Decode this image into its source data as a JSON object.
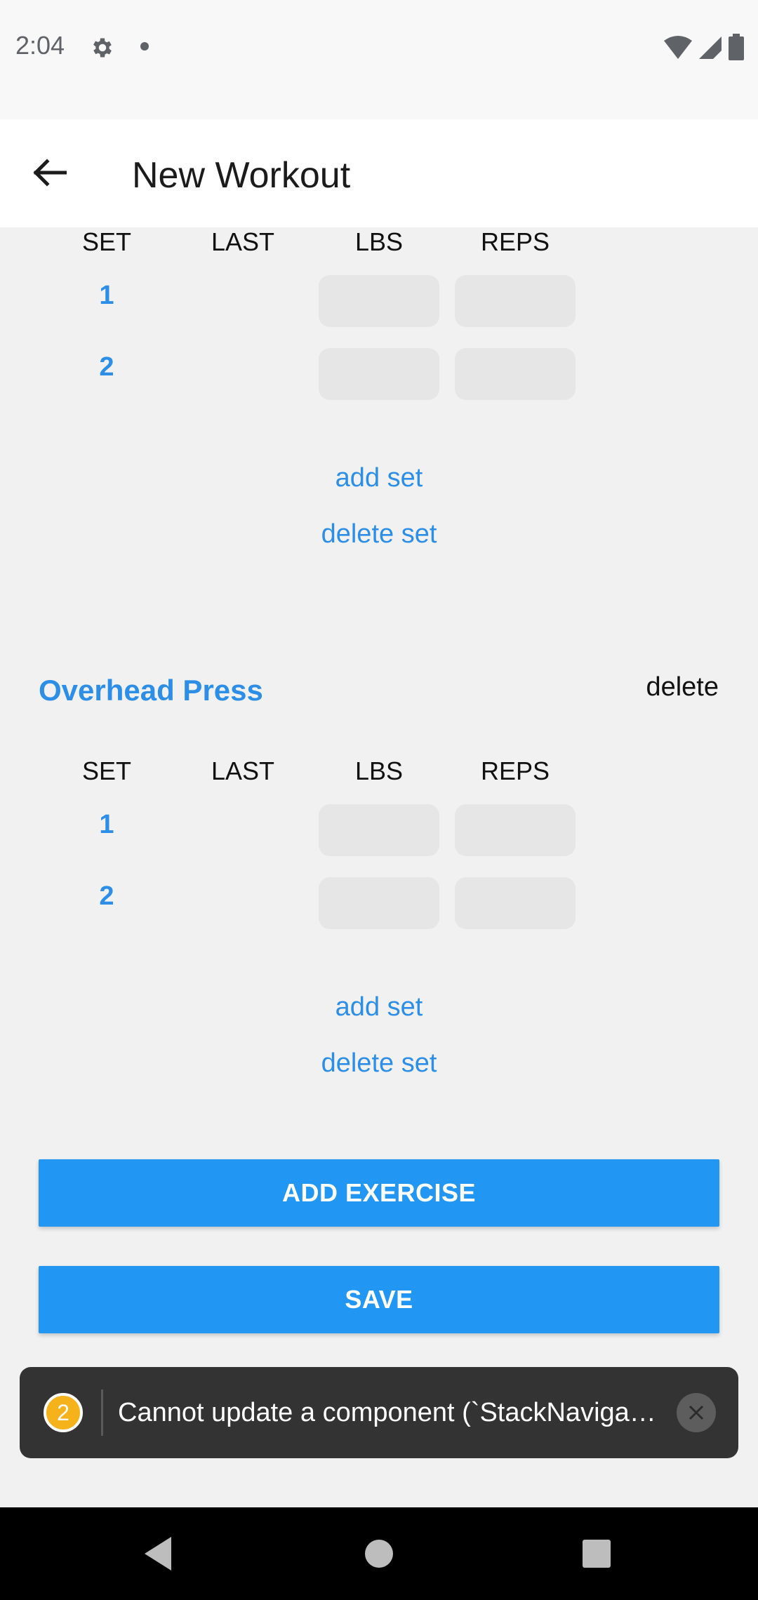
{
  "status_bar": {
    "time": "2:04",
    "icons": [
      "gear-icon",
      "notification-dot-icon",
      "wifi-icon",
      "signal-icon",
      "battery-icon"
    ]
  },
  "header": {
    "title": "New Workout",
    "back_icon": "arrow-left-icon"
  },
  "exercises": [
    {
      "name": "",
      "columns": [
        "SET",
        "LAST",
        "LBS",
        "REPS"
      ],
      "sets": [
        {
          "set": "1",
          "last": "",
          "lbs": "",
          "reps": ""
        },
        {
          "set": "2",
          "last": "",
          "lbs": "",
          "reps": ""
        }
      ],
      "add_set_label": "add set",
      "delete_set_label": "delete set"
    },
    {
      "name": "Overhead Press",
      "delete_label": "delete",
      "columns": [
        "SET",
        "LAST",
        "LBS",
        "REPS"
      ],
      "sets": [
        {
          "set": "1",
          "last": "",
          "lbs": "",
          "reps": ""
        },
        {
          "set": "2",
          "last": "",
          "lbs": "",
          "reps": ""
        }
      ],
      "add_set_label": "add set",
      "delete_set_label": "delete set"
    }
  ],
  "actions": {
    "add_exercise_label": "ADD EXERCISE",
    "save_label": "SAVE"
  },
  "toast": {
    "count": "2",
    "message": "Cannot update a component (`StackNaviga…"
  },
  "colors": {
    "accent": "#2196f3",
    "link": "#2c8ee6",
    "warning_badge": "#f5b21b"
  }
}
